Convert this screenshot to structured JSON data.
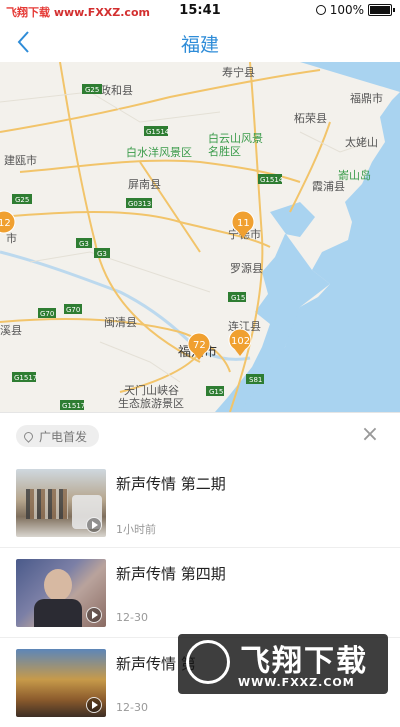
{
  "status_bar": {
    "watermark_top": "飞翔下载",
    "watermark_url": "www.FXXZ.com",
    "time": "15:41",
    "battery": "100%"
  },
  "nav": {
    "title": "福建"
  },
  "map": {
    "labels": {
      "zhenghe": "政和县",
      "shouning": "寿宁县",
      "fuding": "福鼎市",
      "zherong": "柘荣县",
      "baishuiyang": "白水洋风景区",
      "baiyunshan1": "白云山风景",
      "baiyunshan2": "名胜区",
      "taimushan": "太姥山",
      "jianou": "建瓯市",
      "pingnan": "屏南县",
      "xiapu": "霞浦县",
      "ningde": "宁德市",
      "luoyuan": "罗源县",
      "minqing": "闽清县",
      "lianjiang": "连江县",
      "fuzhou": "福州市",
      "tianmen1": "天门山峡谷",
      "tianmen2": "生态旅游景区",
      "xi": "溪县",
      "jiaoyang": "嵛山岛",
      "shi": "市"
    },
    "roads": [
      "G25",
      "G1514",
      "G15",
      "G15",
      "G25",
      "G0313",
      "G3",
      "G3",
      "G70",
      "G70",
      "G15",
      "S81",
      "G1517",
      "G1517",
      "G15",
      "G1514",
      "G1515"
    ],
    "clusters": [
      {
        "count": "12"
      },
      {
        "count": "11"
      },
      {
        "count": "72"
      },
      {
        "count": "102"
      }
    ]
  },
  "panel": {
    "filter_label": "广电首发",
    "items": [
      {
        "title": "新声传情 第二期",
        "time": "1小时前"
      },
      {
        "title": "新声传情 第四期",
        "time": "12-30"
      },
      {
        "title": "新声传情 第",
        "time": "12-30"
      }
    ]
  },
  "watermark": {
    "title": "飞翔下载",
    "url": "WWW.FXXZ.COM"
  },
  "colors": {
    "accent": "#2e8cd8",
    "cluster": "#f0a030",
    "sea": "#a9d3f0"
  }
}
